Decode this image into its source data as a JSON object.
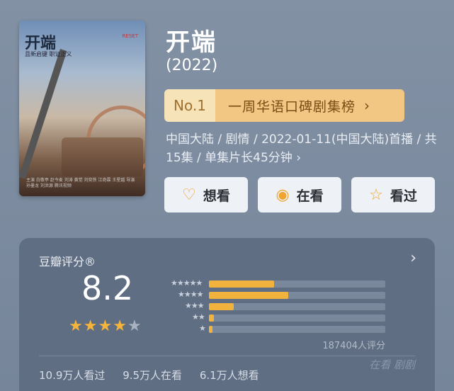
{
  "poster": {
    "title": "开端",
    "subtitle": "且新启键  职证正义",
    "tag": "RESET",
    "credits": "主演 白敬亭 赵今麦 刘涛 黄觉 刘奕铁 江奇霖 王星越 导演 孙墨龙 刘洪源 腾讯视频"
  },
  "title": "开端",
  "year": "(2022)",
  "rank": {
    "number": "No.1",
    "label": "一周华语口碑剧集榜"
  },
  "meta": "中国大陆 / 剧情 / 2022-01-11(中国大陆)首播 / 共15集 / 单集片长45分钟",
  "actions": [
    {
      "label": "想看",
      "icon": "heart-plus-icon"
    },
    {
      "label": "在看",
      "icon": "radio-dot-icon"
    },
    {
      "label": "看过",
      "icon": "star-outline-icon"
    }
  ],
  "rating": {
    "title": "豆瓣评分®",
    "score": "8.2",
    "stars_filled": 4,
    "stars_total": 5,
    "distribution": [
      {
        "stars": "★★★★★",
        "fraction": 0.37
      },
      {
        "stars": "★★★★",
        "fraction": 0.45
      },
      {
        "stars": "★★★",
        "fraction": 0.14
      },
      {
        "stars": "★★",
        "fraction": 0.03
      },
      {
        "stars": "★",
        "fraction": 0.02
      }
    ],
    "count": "187404人评分",
    "stats": [
      "10.9万人看过",
      "9.5万人在看",
      "6.1万人想看"
    ],
    "watermark": "在看 剧剧"
  },
  "colors": {
    "accent": "#f2b23e",
    "rank_bg": "#f2c783"
  }
}
